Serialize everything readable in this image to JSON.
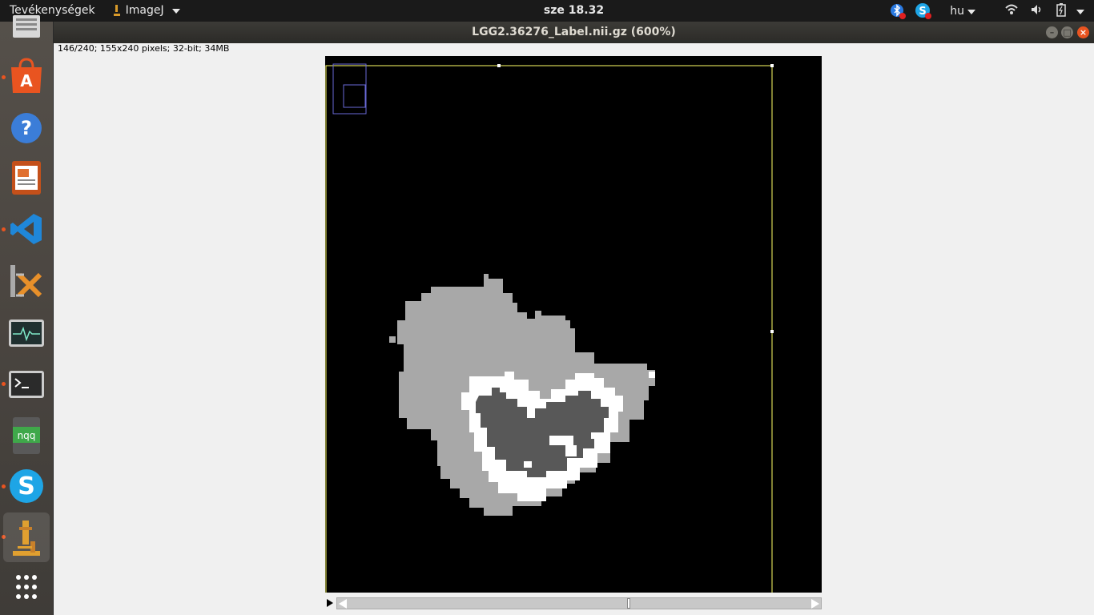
{
  "topbar": {
    "activities": "Tevékenységek",
    "app_name": "ImageJ",
    "clock": "sze 18.32",
    "language": "hu"
  },
  "launcher": {
    "items": [
      {
        "name": "files",
        "icon": "file-manager-icon"
      },
      {
        "name": "software",
        "icon": "software-center-icon"
      },
      {
        "name": "help",
        "icon": "help-icon"
      },
      {
        "name": "impress",
        "icon": "libreoffice-impress-icon"
      },
      {
        "name": "vscode",
        "icon": "vscode-icon"
      },
      {
        "name": "xarchiver",
        "icon": "archive-manager-icon"
      },
      {
        "name": "system-monitor",
        "icon": "system-monitor-icon"
      },
      {
        "name": "terminal",
        "icon": "terminal-icon"
      },
      {
        "name": "nqq",
        "icon": "notepadqq-icon",
        "label": "nqq"
      },
      {
        "name": "skype",
        "icon": "skype-icon"
      },
      {
        "name": "imagej",
        "icon": "microscope-icon"
      },
      {
        "name": "show-apps",
        "icon": "apps-grid-icon"
      }
    ]
  },
  "window": {
    "title": "LGG2.36276_Label.nii.gz (600%)",
    "info": "146/240; 155x240 pixels; 32-bit; 34MB"
  },
  "colors": {
    "accent": "#e95420",
    "roi": "#ffff66",
    "label_light": "#a8a8a8",
    "label_dark": "#585858",
    "label_white": "#ffffff"
  }
}
